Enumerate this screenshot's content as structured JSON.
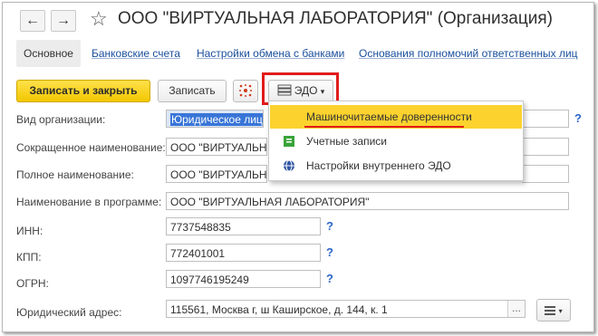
{
  "window": {
    "title": "ООО \"ВИРТУАЛЬНАЯ ЛАБОРАТОРИЯ\" (Организация)",
    "back_glyph": "←",
    "forward_glyph": "→",
    "favorite_glyph": "☆"
  },
  "tabs": [
    {
      "label": "Основное",
      "active": true
    },
    {
      "label": "Банковские счета"
    },
    {
      "label": "Настройки обмена с банками"
    },
    {
      "label": "Основания полномочий ответственных лиц"
    }
  ],
  "toolbar": {
    "save_close_label": "Записать и закрыть",
    "save_label": "Записать",
    "edo_label": "ЭДО",
    "edo_arrow": "▾"
  },
  "menu": {
    "items": [
      {
        "label": "Машиночитаемые доверенности",
        "icon": "none",
        "highlighted": true
      },
      {
        "label": "Учетные записи",
        "icon": "document-green-icon"
      },
      {
        "label": "Настройки внутреннего ЭДО",
        "icon": "settings-globe-icon"
      }
    ]
  },
  "form": {
    "org_type_label": "Вид организации:",
    "org_type_value": "Юридическое лицо",
    "short_name_label": "Сокращенное наименование:",
    "short_name_value": "ООО \"ВИРТУАЛЬНАЯ",
    "full_name_label": "Полное наименование:",
    "full_name_value": "ООО \"ВИРТУАЛЬНАЯ",
    "program_name_label": "Наименование в программе:",
    "program_name_value": "ООО \"ВИРТУАЛЬНАЯ ЛАБОРАТОРИЯ\"",
    "inn_label": "ИНН:",
    "inn_value": "7737548835",
    "kpp_label": "КПП:",
    "kpp_value": "772401001",
    "ogrn_label": "ОГРН:",
    "ogrn_value": "1097746195249",
    "address_label": "Юридический адрес:",
    "address_value": "115561, Москва г, ш Каширское, д. 144, к. 1",
    "address_dots": "...",
    "help_glyph": "?"
  },
  "colors": {
    "accent_yellow": "#f2c700",
    "highlight_red": "#e01b1b",
    "link_blue": "#1a4f9c"
  }
}
